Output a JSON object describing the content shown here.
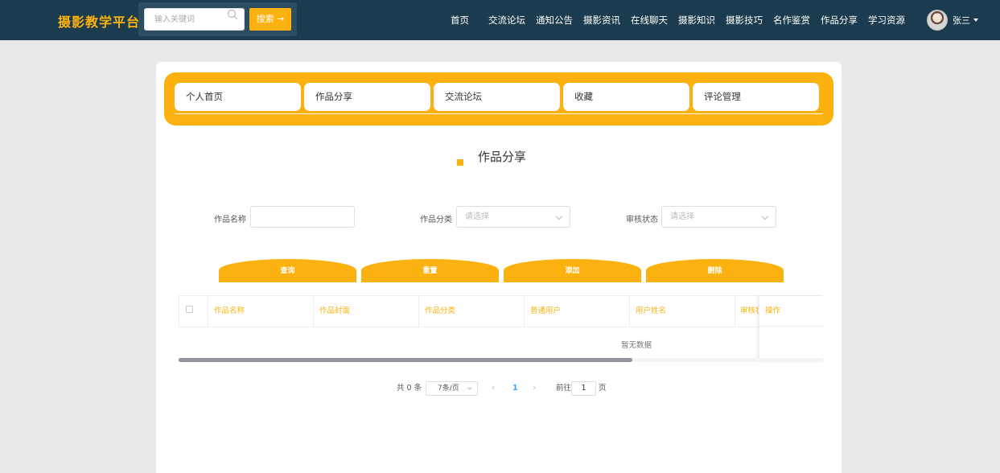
{
  "brand": "摄影教学平台",
  "search": {
    "placeholder": "输入关键词",
    "button": "搜索 →"
  },
  "nav": [
    "首页",
    "交流论坛",
    "通知公告",
    "摄影资讯",
    "在线聊天",
    "摄影知识",
    "摄影技巧",
    "名作鉴赏",
    "作品分享",
    "学习资源"
  ],
  "user": {
    "name": "张三"
  },
  "tabs": [
    "个人首页",
    "作品分享",
    "交流论坛",
    "收藏",
    "评论管理"
  ],
  "section_title": "作品分享",
  "filters": {
    "name_label": "作品名称",
    "category_label": "作品分类",
    "category_placeholder": "请选择",
    "status_label": "审核状态",
    "status_placeholder": "请选择"
  },
  "actions": [
    "查询",
    "重置",
    "添加",
    "删除"
  ],
  "table": {
    "columns": [
      "作品名称",
      "作品封面",
      "作品分类",
      "普通用户",
      "用户姓名",
      "审核状态",
      "操作"
    ],
    "empty_text": "暂无数据"
  },
  "pagination": {
    "total": "共 0 条",
    "page_size": "7条/页",
    "current_page": "1",
    "goto_label": "前往",
    "goto_value": "1",
    "page_suffix": "页"
  },
  "colors": {
    "header_bg": "#1b3c4f",
    "accent": "#fbb10f"
  }
}
